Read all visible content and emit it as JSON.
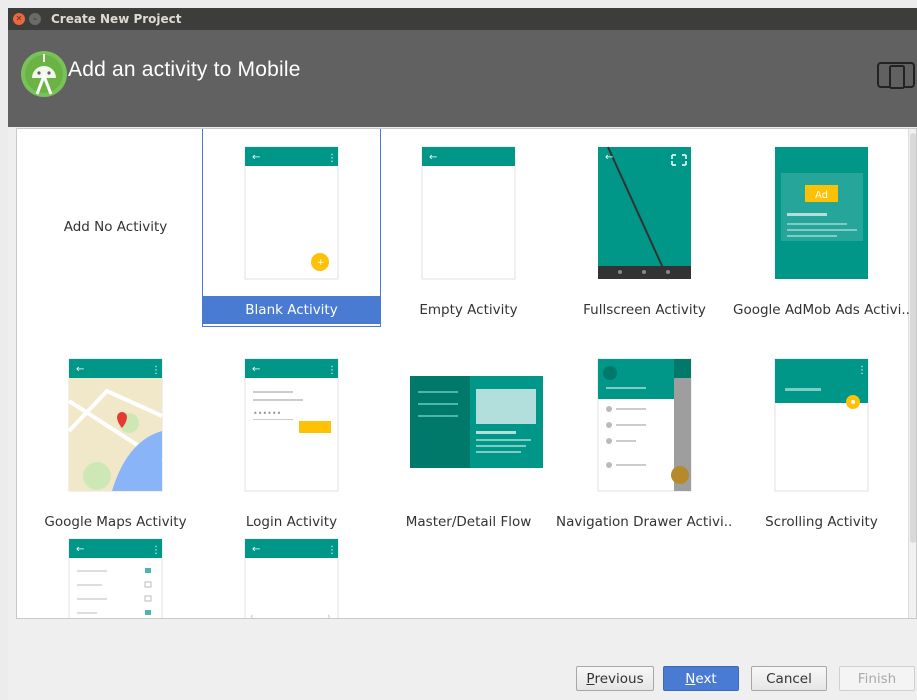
{
  "window": {
    "title": "Create New Project",
    "close_glyph": "✕",
    "min_glyph": "–"
  },
  "header": {
    "title": "Add an activity to Mobile",
    "logo_icon": "android-studio-icon",
    "device_icon": "tablet-phone-icon"
  },
  "activities": [
    {
      "label": "Add No Activity",
      "selected": false
    },
    {
      "label": "Blank Activity",
      "selected": true
    },
    {
      "label": "Empty Activity",
      "selected": false
    },
    {
      "label": "Fullscreen Activity",
      "selected": false
    },
    {
      "label": "Google AdMob Ads Activi...",
      "selected": false
    },
    {
      "label": "Google Maps Activity",
      "selected": false
    },
    {
      "label": "Login Activity",
      "selected": false
    },
    {
      "label": "Master/Detail Flow",
      "selected": false
    },
    {
      "label": "Navigation Drawer Activi...",
      "selected": false
    },
    {
      "label": "Scrolling Activity",
      "selected": false
    }
  ],
  "ad_badge": "Ad",
  "buttons": {
    "previous": {
      "mnemonic": "P",
      "rest": "revious"
    },
    "next": {
      "mnemonic": "N",
      "rest": "ext"
    },
    "cancel": "Cancel",
    "finish": "Finish"
  },
  "colors": {
    "accent": "#4a7bd2",
    "teal": "#009688",
    "teal_dark": "#00796b",
    "header_bg": "#616161",
    "fab_yellow": "#ffc107"
  }
}
